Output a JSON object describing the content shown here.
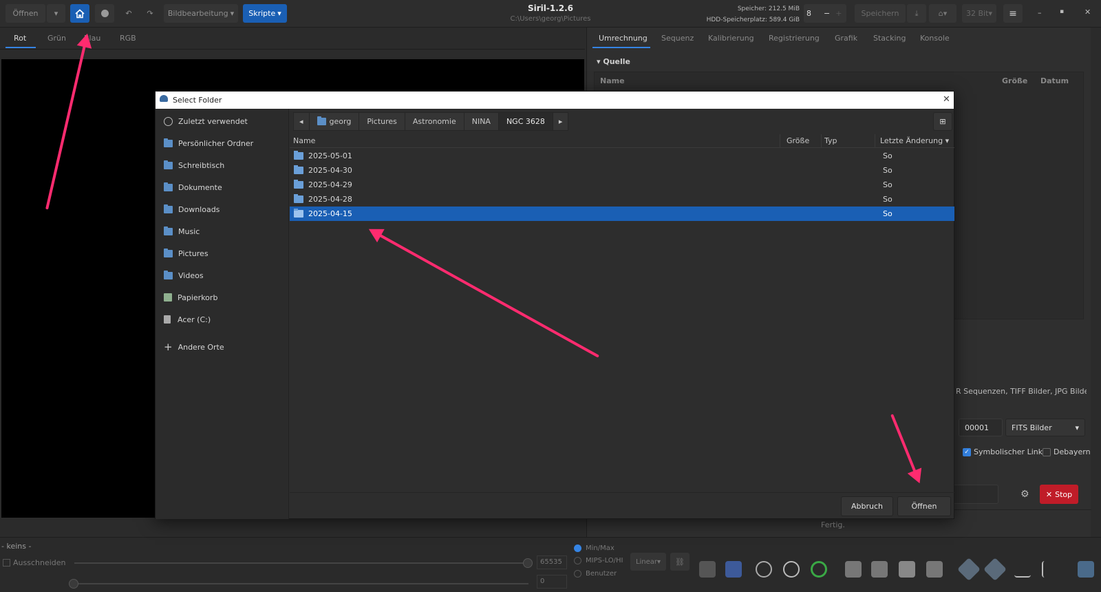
{
  "app": {
    "title": "Siril-1.2.6",
    "path": "C:\\Users\\georg\\Pictures",
    "memory": "Speicher: 212.5 MiB",
    "hdd": "HDD-Speicherplatz: 589.4 GiB"
  },
  "toolbar": {
    "open": "Öffnen",
    "image_edit": "Bildbearbeitung",
    "scripts": "Skripte",
    "threads": "8",
    "save": "Speichern",
    "bits": "32 Bit"
  },
  "left_tabs": [
    "Rot",
    "Grün",
    "Blau",
    "RGB"
  ],
  "right_tabs": [
    "Umrechnung",
    "Sequenz",
    "Kalibrierung",
    "Registrierung",
    "Grafik",
    "Stacking",
    "Konsole"
  ],
  "right_panel": {
    "source_label": "Quelle",
    "col_name": "Name",
    "col_size": "Größe",
    "col_date": "Datum",
    "formats_text": "R Sequenzen, TIFF Bilder, JPG Bilder,",
    "number": "00001",
    "format": "FITS Bilder",
    "symlink": "Symbolischer Link",
    "debayer": "Debayern",
    "stop": "Stop",
    "status": "Fertig."
  },
  "bottom": {
    "none": "- keins -",
    "crop": "Ausschneiden",
    "max": "65535",
    "min": "0",
    "minmax": "Min/Max",
    "mips": "MIPS-LO/HI",
    "user": "Benutzer",
    "linear": "Linear"
  },
  "dialog": {
    "title": "Select Folder",
    "sidebar": [
      "Zuletzt verwendet",
      "Persönlicher Ordner",
      "Schreibtisch",
      "Dokumente",
      "Downloads",
      "Music",
      "Pictures",
      "Videos",
      "Papierkorb",
      "Acer (C:)",
      "Andere Orte"
    ],
    "path": [
      "georg",
      "Pictures",
      "Astronomie",
      "NINA",
      "NGC 3628"
    ],
    "columns": {
      "name": "Name",
      "size": "Größe",
      "type": "Typ",
      "modified": "Letzte Änderung"
    },
    "rows": [
      {
        "name": "2025-05-01",
        "modified": "So"
      },
      {
        "name": "2025-04-30",
        "modified": "So"
      },
      {
        "name": "2025-04-29",
        "modified": "So"
      },
      {
        "name": "2025-04-28",
        "modified": "So"
      },
      {
        "name": "2025-04-15",
        "modified": "So"
      }
    ],
    "cancel": "Abbruch",
    "open": "Öffnen"
  }
}
